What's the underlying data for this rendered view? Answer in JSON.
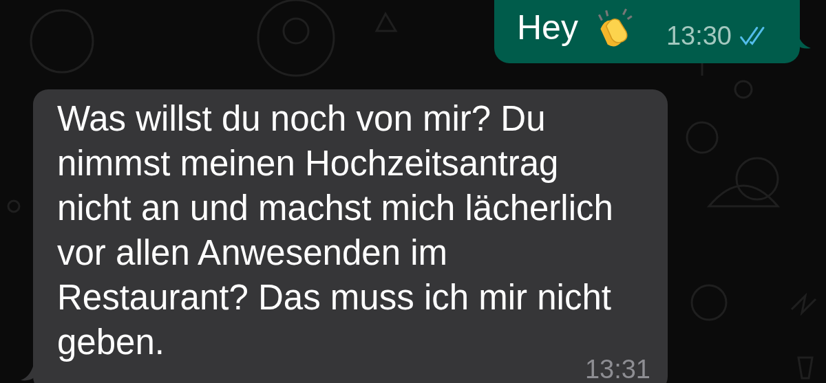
{
  "messages": [
    {
      "kind": "outgoing",
      "text": "Hey",
      "emoji": true,
      "time": "13:30",
      "read": true
    },
    {
      "kind": "incoming",
      "lines": [
        "Was willst du noch von mir? Du",
        "nimmst meinen Hochzeitsantrag",
        "nicht an und machst mich lächerlich",
        "vor allen Anwesenden im",
        "Restaurant? Das muss ich mir nicht",
        "geben."
      ],
      "time": "13:31"
    }
  ]
}
